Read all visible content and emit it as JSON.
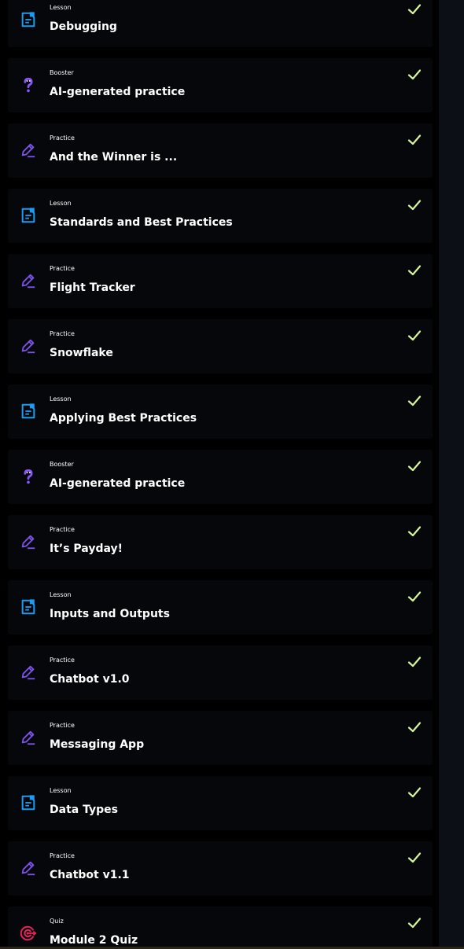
{
  "theme": {
    "lesson_color": "#1e9bf0",
    "practice_color": "#7c52e8",
    "booster_color": "#8b55ff",
    "quiz_color": "#e4245a",
    "check_color": "#d7f59a"
  },
  "items": [
    {
      "type": "Lesson",
      "title": "Debugging",
      "icon": "document-icon",
      "status": "completed"
    },
    {
      "type": "Booster",
      "title": "AI-generated practice",
      "icon": "question-icon",
      "status": "completed"
    },
    {
      "type": "Practice",
      "title": "And the Winner is ...",
      "icon": "pencil-icon",
      "status": "completed"
    },
    {
      "type": "Lesson",
      "title": "Standards and Best Practices",
      "icon": "document-icon",
      "status": "completed"
    },
    {
      "type": "Practice",
      "title": "Flight Tracker",
      "icon": "pencil-icon",
      "status": "completed"
    },
    {
      "type": "Practice",
      "title": "Snowflake",
      "icon": "pencil-icon",
      "status": "completed"
    },
    {
      "type": "Lesson",
      "title": "Applying Best Practices",
      "icon": "document-icon",
      "status": "completed"
    },
    {
      "type": "Booster",
      "title": "AI-generated practice",
      "icon": "question-icon",
      "status": "completed"
    },
    {
      "type": "Practice",
      "title": "It’s Payday!",
      "icon": "pencil-icon",
      "status": "completed"
    },
    {
      "type": "Lesson",
      "title": "Inputs and Outputs",
      "icon": "document-icon",
      "status": "completed"
    },
    {
      "type": "Practice",
      "title": "Chatbot v1.0",
      "icon": "pencil-icon",
      "status": "completed"
    },
    {
      "type": "Practice",
      "title": "Messaging App",
      "icon": "pencil-icon",
      "status": "completed"
    },
    {
      "type": "Lesson",
      "title": "Data Types",
      "icon": "document-icon",
      "status": "completed"
    },
    {
      "type": "Practice",
      "title": "Chatbot v1.1",
      "icon": "pencil-icon",
      "status": "completed"
    },
    {
      "type": "Quiz",
      "title": "Module 2 Quiz",
      "icon": "target-icon",
      "status": "completed"
    }
  ]
}
